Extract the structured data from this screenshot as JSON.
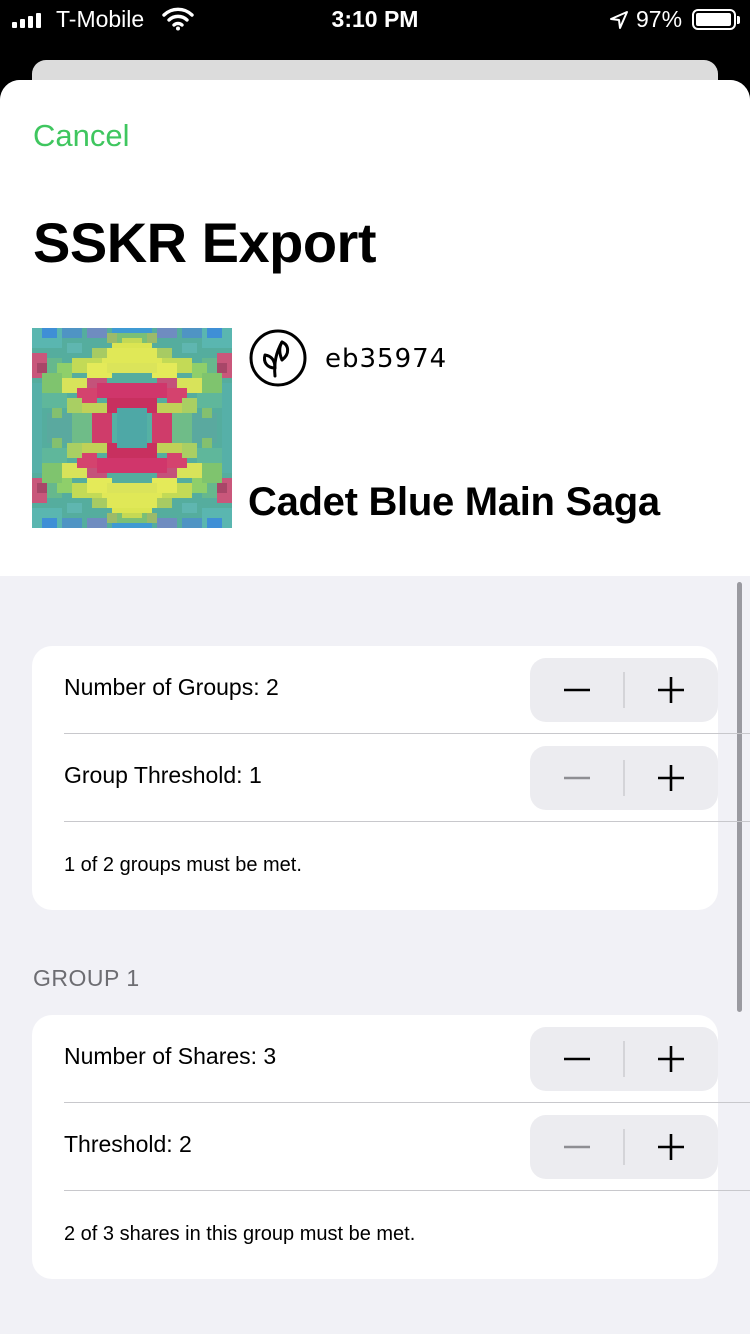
{
  "status_bar": {
    "carrier": "T-Mobile",
    "time": "3:10 PM",
    "battery_percent": "97%"
  },
  "nav": {
    "cancel_label": "Cancel"
  },
  "title": "SSKR Export",
  "seed": {
    "id": "eb35974",
    "name": "Cadet Blue Main Saga"
  },
  "groups_section": {
    "rows": [
      {
        "label": "Number of Groups: 2",
        "decrement_enabled": true
      },
      {
        "label": "Group Threshold: 1",
        "decrement_enabled": false
      }
    ],
    "note": "1 of 2 groups must be met."
  },
  "group1_section": {
    "header": "GROUP 1",
    "rows": [
      {
        "label": "Number of Shares: 3",
        "decrement_enabled": true
      },
      {
        "label": "Threshold: 2",
        "decrement_enabled": false
      }
    ],
    "note": "2 of 3 shares in this group must be met."
  },
  "colors": {
    "accent": "#3fc65f",
    "enabled_icon": "#000000",
    "disabled_icon": "#8e8e93",
    "grouped_background": "#f1f1f6"
  }
}
